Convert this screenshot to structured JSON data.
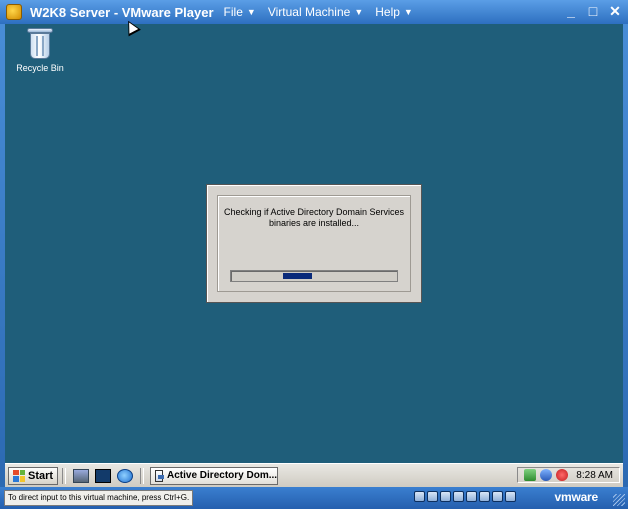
{
  "window": {
    "title": "W2K8 Server - VMware Player",
    "menu": [
      {
        "label": "File",
        "has_dropdown": true
      },
      {
        "label": "Virtual Machine",
        "has_dropdown": true
      },
      {
        "label": "Help",
        "has_dropdown": true
      }
    ],
    "controls": {
      "minimize": "_",
      "maximize": "□",
      "close": "✕"
    }
  },
  "desktop": {
    "icons": [
      {
        "label": "Recycle Bin",
        "icon": "recycle-bin-icon"
      }
    ]
  },
  "dialog": {
    "message": "Checking if Active Directory Domain Services binaries are installed...",
    "progress_position": 0.31,
    "progress_width": 0.18
  },
  "taskbar": {
    "start_label": "Start",
    "quick_launch": [
      "server-manager-icon",
      "command-prompt-icon",
      "internet-explorer-icon"
    ],
    "tasks": [
      {
        "label": "Active Directory Dom..."
      }
    ],
    "tray": [
      "network-icon",
      "security-icon",
      "alert-icon"
    ],
    "clock": "8:28 AM"
  },
  "statusbar": {
    "hint": "To direct input to this virtual machine, press Ctrl+G.",
    "brand": "vmware",
    "devices": [
      "hdd-icon",
      "cdrom-icon",
      "floppy-icon",
      "usb-icon",
      "network-adapter-icon",
      "sound-icon",
      "display-icon",
      "message-icon"
    ]
  },
  "colors": {
    "desktop": "#1f5e7a",
    "vmware_chrome": "#2d6fc0",
    "dialog_bg": "#d6d3ce",
    "progress_fill": "#0a2a7a"
  }
}
